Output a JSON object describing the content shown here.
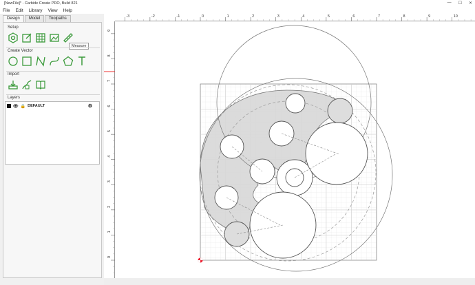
{
  "window": {
    "title": "[NewFile]* - Carbide Create PRO, Build 821"
  },
  "menu": [
    "File",
    "Edit",
    "Library",
    "View",
    "Help"
  ],
  "tabs": [
    "Design",
    "Model",
    "Toolpaths"
  ],
  "sections": {
    "setup": "Setup",
    "create_vector": "Create Vector",
    "import": "Import",
    "layers": "Layers"
  },
  "tooltip": "Measure",
  "layer": {
    "name": "DEFAULT"
  },
  "ruler": {
    "x_ticks": [
      "-3",
      "-2",
      "-1",
      "0",
      "1",
      "2",
      "3",
      "4",
      "5",
      "6",
      "7",
      "8",
      "9",
      "10"
    ],
    "y_ticks": [
      "9",
      "8",
      "7",
      "6",
      "5",
      "4",
      "3",
      "2",
      "1",
      "0"
    ]
  }
}
